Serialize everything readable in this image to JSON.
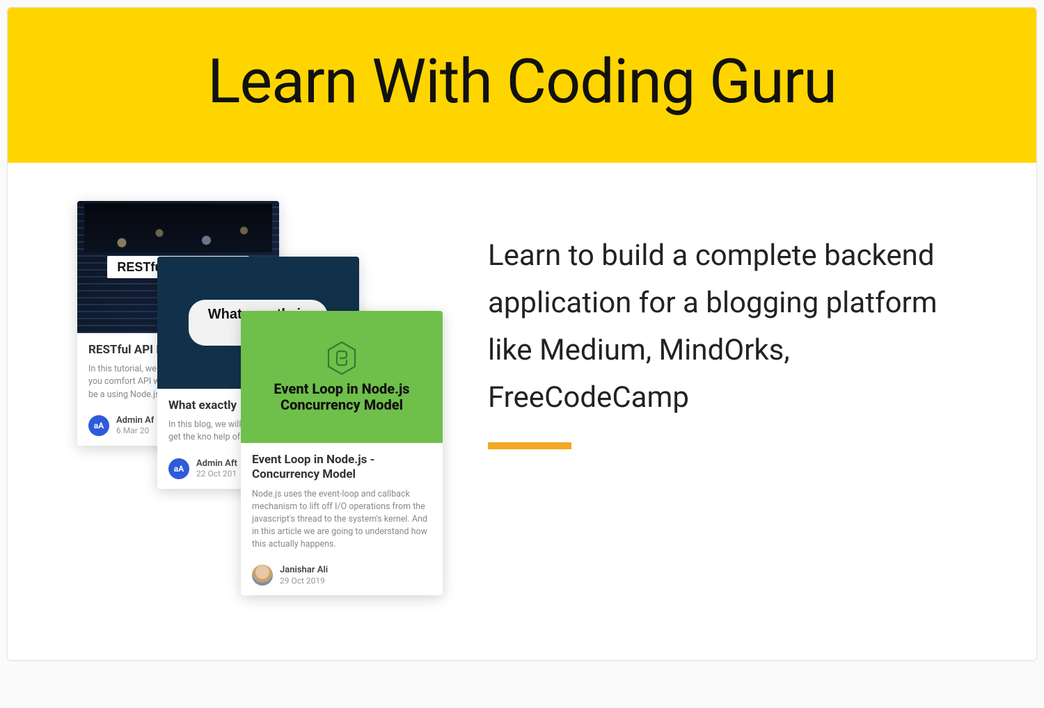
{
  "banner": {
    "title": "Learn With Coding Guru"
  },
  "hero": {
    "text": "Learn to build a complete backend application for a blogging platform like Medium, MindOrks, FreeCodeCamp"
  },
  "cards": [
    {
      "coverLabel": "RESTful API in Node",
      "title": "RESTful API Express",
      "snippet": "In this tutorial, we API using Node an make you comfort API with Node.js a blog, you will be a using Node.js and",
      "author": "Admin Af",
      "date": "6 Mar 20",
      "avatar": "aA"
    },
    {
      "coverLabel": "What exactly is API?",
      "title": "What exactly",
      "snippet": "In this blog, we will what exactly is API you will get the kno help of some conc example.",
      "author": "Admin Aft",
      "date": "22 Oct 201",
      "avatar": "aA"
    },
    {
      "coverLabel": "Event Loop in Node.js Concurrency Model",
      "title": "Event Loop in Node.js - Concurrency Model",
      "snippet": "Node.js uses the event-loop and callback mechanism to lift off I/O operations from the javascript's thread to the system's kernel. And in this article we are going to understand how this actually happens.",
      "author": "Janishar Ali",
      "date": "29 Oct 2019"
    }
  ]
}
